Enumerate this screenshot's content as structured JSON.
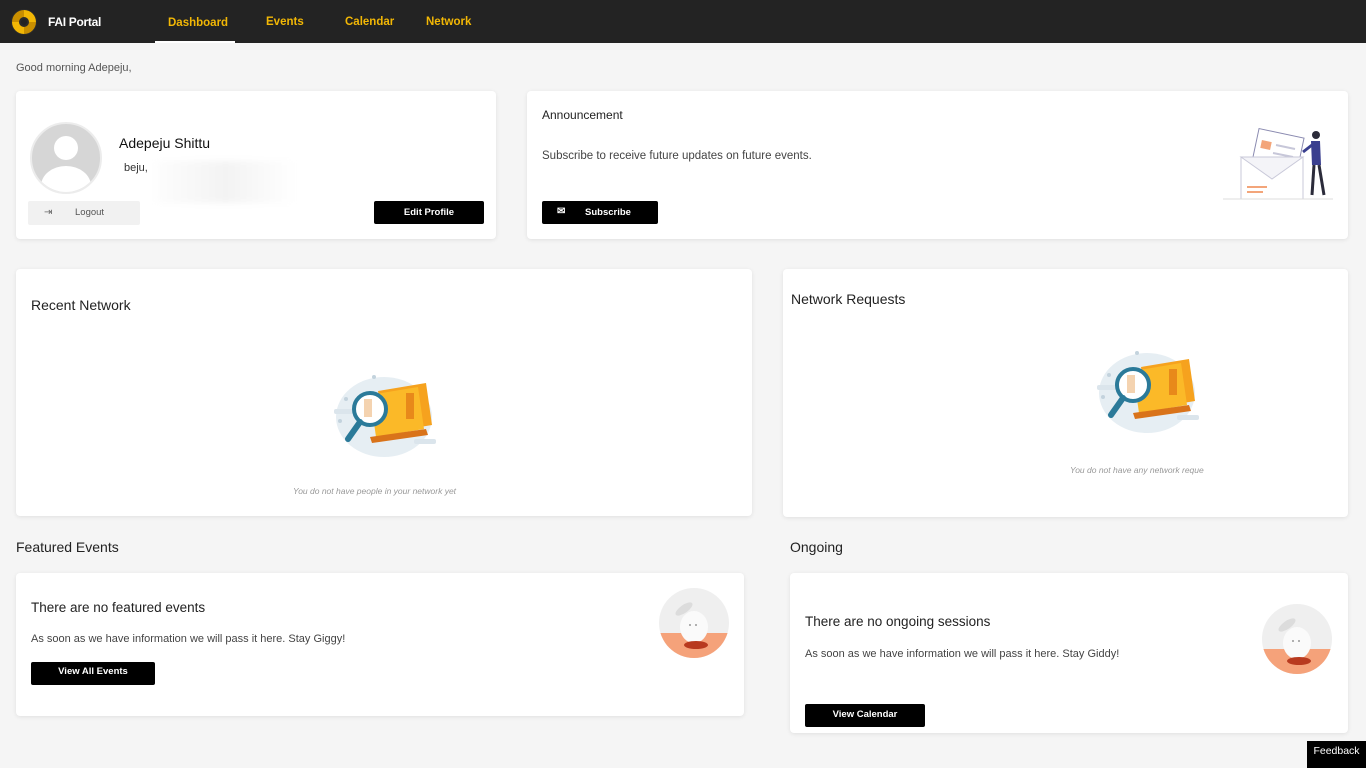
{
  "app": {
    "brand": "FAI Portal"
  },
  "nav": {
    "dashboard": "Dashboard",
    "events": "Events",
    "calendar": "Calendar",
    "network": "Network"
  },
  "greeting": "Good morning Adepeju,",
  "profile": {
    "name": "Adepeju Shittu",
    "email_partial": "beju,",
    "logout_label": "Logout",
    "edit_label": "Edit Profile"
  },
  "announcement": {
    "title": "Announcement",
    "text": "Subscribe to receive future updates on future events.",
    "subscribe_label": "Subscribe"
  },
  "recent_network": {
    "title": "Recent Network",
    "empty_text": "You do not have people in your network yet"
  },
  "network_requests": {
    "title": "Network Requests",
    "empty_text": "You do not have any network reque"
  },
  "featured": {
    "section_title": "Featured Events",
    "title": "There are no featured events",
    "text": "As soon as we have information we will pass it here. Stay Giggy!",
    "button": "View All Events"
  },
  "ongoing": {
    "section_title": "Ongoing",
    "title": "There are no ongoing sessions",
    "text": "As soon as we have information we will pass it here. Stay Giddy!",
    "button": "View Calendar"
  },
  "feedback_label": "Feedback",
  "colors": {
    "nav_bg": "#232323",
    "accent": "#f2b705",
    "button": "#000000",
    "page_bg": "#f5f5f5"
  }
}
